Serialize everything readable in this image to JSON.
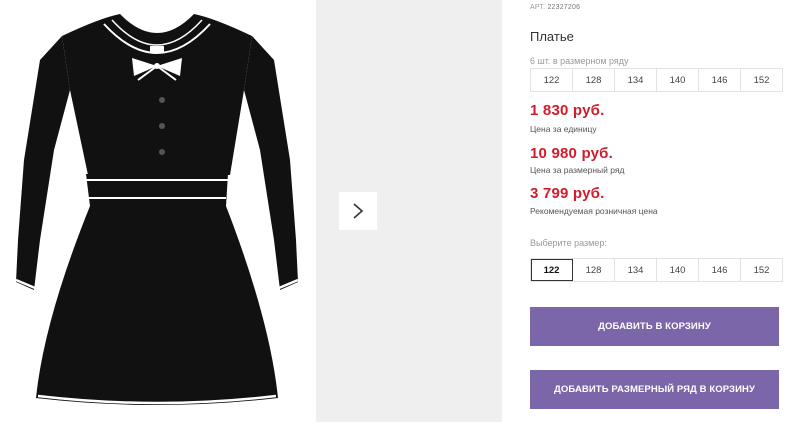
{
  "product": {
    "article_label": "АРТ.",
    "article_number": "22327206",
    "title": "Платье"
  },
  "pack": {
    "caption": "6 шт. в размерном ряду",
    "sizes": [
      "122",
      "128",
      "134",
      "140",
      "146",
      "152"
    ]
  },
  "prices": [
    {
      "value": "1 830 руб.",
      "caption": "Цена за единицу"
    },
    {
      "value": "10 980 руб.",
      "caption": "Цена за размерный ряд"
    },
    {
      "value": "3 799 руб.",
      "caption": "Рекомендуемая розничная цена"
    }
  ],
  "size_select": {
    "caption": "Выберите размер:",
    "options": [
      "122",
      "128",
      "134",
      "140",
      "146",
      "152"
    ],
    "selected": "122"
  },
  "buttons": {
    "add_to_cart": "ДОБАВИТЬ В КОРЗИНУ",
    "add_pack_to_cart": "ДОБАВИТЬ РАЗМЕРНЫЙ РЯД В КОРЗИНУ"
  },
  "icons": {
    "next": "chevron-right-icon"
  },
  "colors": {
    "price": "#d31b2b",
    "button": "#7a66a8",
    "dress": "#111111",
    "next_photo_bg": "#efefef"
  }
}
